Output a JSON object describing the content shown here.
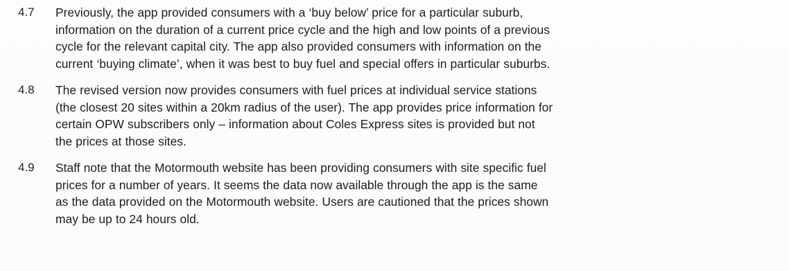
{
  "paragraphs": [
    {
      "number": "4.7",
      "lines": [
        "Previously, the app provided consumers with a ‘buy below’ price for a particular suburb,",
        "information on the duration of a current price cycle and the high and low points of a previous",
        "cycle for the relevant capital city. The app also provided consumers with information on the",
        "current ‘buying climate’, when it was best to buy fuel and special offers in particular suburbs."
      ]
    },
    {
      "number": "4.8",
      "lines": [
        "The revised version now provides consumers with fuel prices at individual service stations",
        "(the closest 20 sites within a 20km radius of the user). The app provides price information for",
        "certain OPW subscribers only – information about Coles Express sites is provided but not",
        "the prices at those sites."
      ]
    },
    {
      "number": "4.9",
      "lines": [
        "Staff note that the Motormouth website has been providing consumers with site specific fuel",
        "prices for a number of years. It seems the data now available through the app is the same",
        "as the data provided on the Motormouth website. Users are cautioned that the prices shown",
        "may be up to 24 hours old."
      ]
    }
  ]
}
